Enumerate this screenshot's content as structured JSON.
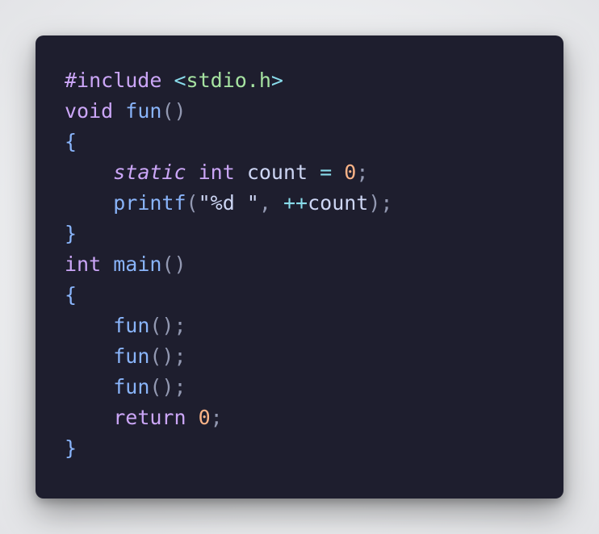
{
  "code": {
    "language": "c",
    "line1": {
      "directive": "#include",
      "header_open": "<",
      "header": "stdio.h",
      "header_close": ">"
    },
    "line2": {
      "type": "void",
      "name": "fun",
      "parens": "()"
    },
    "line3": {
      "brace": "{"
    },
    "line4": {
      "storage": "static",
      "type": "int",
      "var": "count",
      "eq": "=",
      "value": "0",
      "semi": ";"
    },
    "line5": {
      "call": "printf",
      "open": "(",
      "string": "\"%d \"",
      "comma": ",",
      "op": "++",
      "var": "count",
      "close": ")",
      "semi": ";"
    },
    "line6": {
      "brace": "}"
    },
    "line7": {
      "type": "int",
      "name": "main",
      "parens": "()"
    },
    "line8": {
      "brace": "{"
    },
    "line9": {
      "call": "fun",
      "parens": "()",
      "semi": ";"
    },
    "line10": {
      "call": "fun",
      "parens": "()",
      "semi": ";"
    },
    "line11": {
      "call": "fun",
      "parens": "()",
      "semi": ";"
    },
    "line12": {
      "keyword": "return",
      "value": "0",
      "semi": ";"
    },
    "line13": {
      "brace": "}"
    }
  },
  "colors": {
    "background": "#1e1e2e",
    "keyword": "#cba6f7",
    "function": "#89b4fa",
    "string": "#a6e3a1",
    "number": "#fab387",
    "operator": "#89dceb",
    "text": "#cdd6f4"
  }
}
